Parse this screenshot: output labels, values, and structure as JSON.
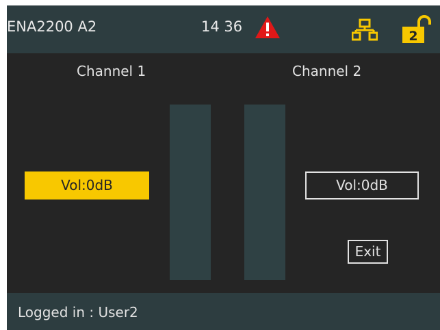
{
  "header": {
    "device_name": "ENA2200 A2",
    "time": "14 36",
    "icons": {
      "warning": "warning-triangle-icon",
      "network": "network-icon",
      "lock": "unlock-icon"
    },
    "lock_level": "2"
  },
  "channels": [
    {
      "label": "Channel 1",
      "volume": "Vol:0dB"
    },
    {
      "label": "Channel 2",
      "volume": "Vol:0dB"
    }
  ],
  "actions": {
    "exit_label": "Exit"
  },
  "status_bar": {
    "text": "Logged in : User2"
  },
  "colors": {
    "background": "#252525",
    "bar_background": "#2d3d40",
    "meter": "#2f4144",
    "accent": "#f8c800",
    "warning": "#e01818",
    "text": "#e2e2e2"
  }
}
